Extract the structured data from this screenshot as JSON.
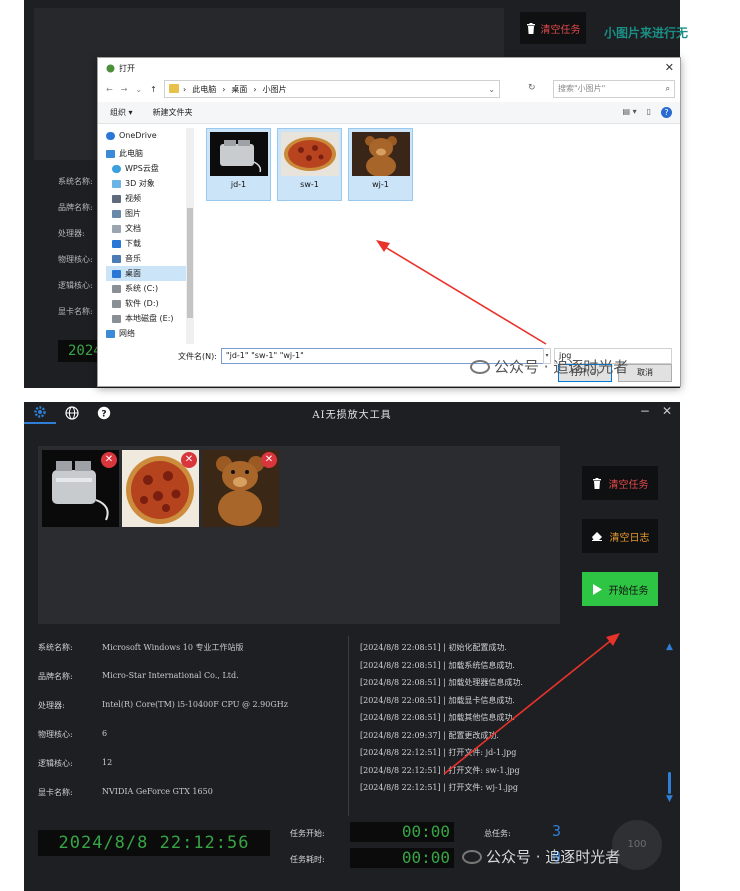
{
  "top": {
    "clear_task_label": "清空任务",
    "right_text": "小图片来进行无",
    "info_labels": [
      "系统名称:",
      "品牌名称:",
      "处理器:",
      "物理核心:",
      "逻辑核心:",
      "显卡名称:"
    ],
    "info_cut": [
      "M",
      "M",
      "Ir",
      "6",
      "12",
      "N"
    ],
    "clock_fragment": "2024/",
    "dialog": {
      "title": "打开",
      "address": [
        "此电脑",
        "桌面",
        "小图片"
      ],
      "search_placeholder": "搜索\"小图片\"",
      "organize": "组织 ▾",
      "new_folder": "新建文件夹",
      "tree": [
        "OneDrive",
        "此电脑",
        "WPS云盘",
        "3D 对象",
        "视频",
        "图片",
        "文档",
        "下载",
        "音乐",
        "桌面",
        "系统 (C:)",
        "软件 (D:)",
        "本地磁盘 (E:)",
        "网络"
      ],
      "files": [
        "jd-1",
        "sw-1",
        "wj-1"
      ],
      "filename_label": "文件名(N):",
      "filename_value": "\"jd-1\" \"sw-1\" \"wj-1\"",
      "filetype": "jpg",
      "open_button": "打开(O)",
      "cancel_button": "取消"
    }
  },
  "watermark": {
    "text1": "公众号 · 追逐时光者",
    "text2": "公众号 · 追逐时光者"
  },
  "app": {
    "title": "AI无损放大工具",
    "buttons": {
      "clear_task": "清空任务",
      "clear_log": "清空日志",
      "start_task": "开始任务"
    },
    "info": [
      {
        "k": "系统名称:",
        "v": "Microsoft Windows 10 专业工作站版"
      },
      {
        "k": "品牌名称:",
        "v": "Micro-Star International Co., Ltd."
      },
      {
        "k": "处理器:",
        "v": "Intel(R) Core(TM) i5-10400F CPU @ 2.90GHz"
      },
      {
        "k": "物理核心:",
        "v": "6"
      },
      {
        "k": "逻辑核心:",
        "v": "12"
      },
      {
        "k": "显卡名称:",
        "v": "NVIDIA GeForce GTX 1650"
      }
    ],
    "log": [
      "[2024/8/8 22:08:51] | 初始化配置成功.",
      "[2024/8/8 22:08:51] | 加载系统信息成功.",
      "[2024/8/8 22:08:51] | 加载处理器信息成功.",
      "[2024/8/8 22:08:51] | 加载显卡信息成功.",
      "[2024/8/8 22:08:51] | 加载其他信息成功.",
      "[2024/8/8 22:09:37] | 配置更改成功.",
      "[2024/8/8 22:12:51] | 打开文件: jd-1.jpg",
      "[2024/8/8 22:12:51] | 打开文件: sw-1.jpg",
      "[2024/8/8 22:12:51] | 打开文件: wj-1.jpg"
    ],
    "clock": "2024/8/8 22:12:56",
    "task_start_label": "任务开始:",
    "task_start_value": "00:00",
    "task_elapsed_label": "任务耗时:",
    "task_elapsed_value": "00:00",
    "total_tasks_label": "总任务:",
    "total_tasks_value": "3",
    "done_tasks_value": "0",
    "circle_text": "100"
  },
  "colors": {
    "accent_blue": "#2f7fd6",
    "start_green": "#2ec444",
    "clock_green": "#37a446",
    "delete_red": "#d9353c",
    "clear_red": "#e24a4a",
    "clear_log_orange": "#e69a2e"
  }
}
